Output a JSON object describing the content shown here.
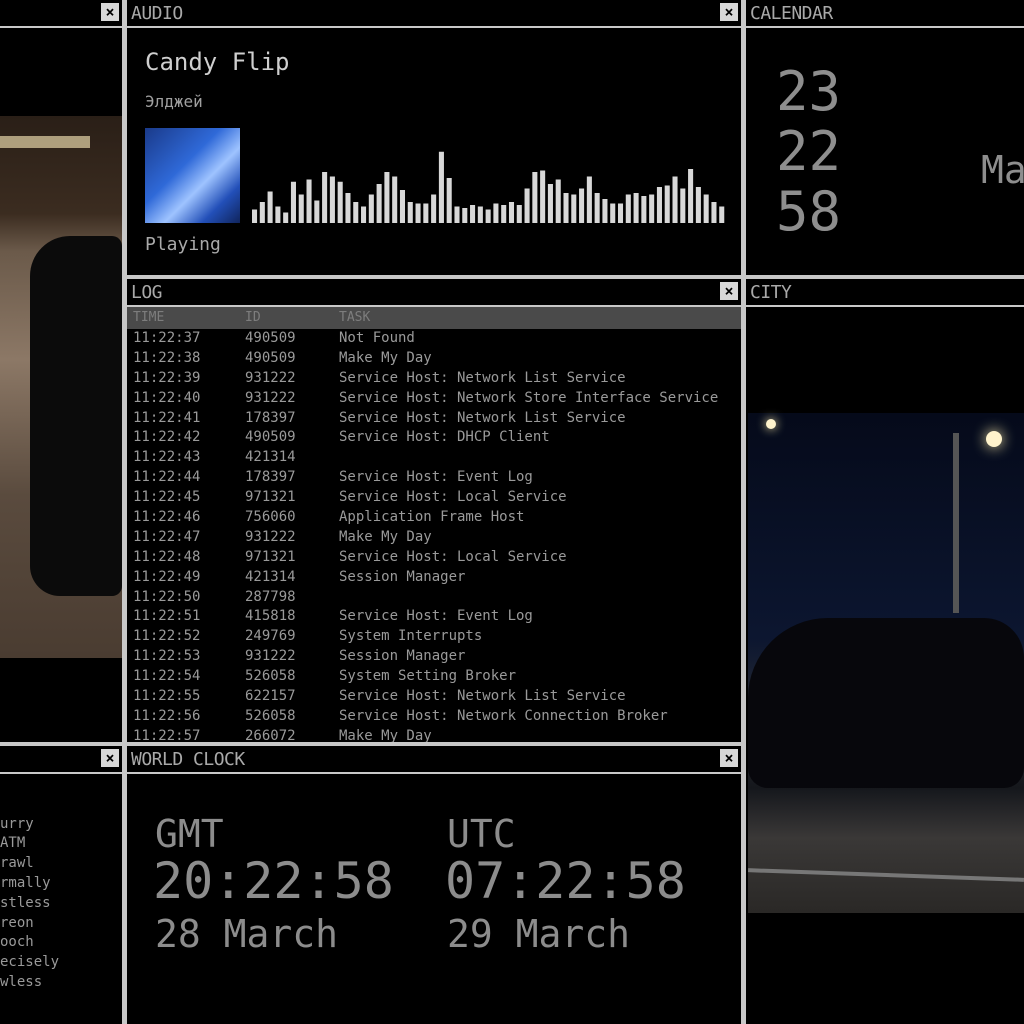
{
  "panels": {
    "audio": {
      "title": "AUDIO"
    },
    "calendar": {
      "title": "CALENDAR"
    },
    "log": {
      "title": "LOG"
    },
    "city": {
      "title": "CITY"
    },
    "world_clock": {
      "title": "WORLD CLOCK"
    },
    "close_glyph": "×"
  },
  "audio": {
    "track": "Candy Flip",
    "artist": "Элджей",
    "status": "Playing",
    "levels": [
      0.18,
      0.28,
      0.42,
      0.22,
      0.14,
      0.55,
      0.38,
      0.58,
      0.3,
      0.68,
      0.62,
      0.55,
      0.4,
      0.28,
      0.22,
      0.38,
      0.52,
      0.68,
      0.62,
      0.44,
      0.28,
      0.26,
      0.26,
      0.38,
      0.95,
      0.6,
      0.22,
      0.2,
      0.24,
      0.22,
      0.18,
      0.26,
      0.24,
      0.28,
      0.24,
      0.46,
      0.68,
      0.7,
      0.52,
      0.58,
      0.4,
      0.38,
      0.46,
      0.62,
      0.4,
      0.32,
      0.26,
      0.26,
      0.38,
      0.4,
      0.36,
      0.38,
      0.48,
      0.5,
      0.62,
      0.46,
      0.72,
      0.48,
      0.38,
      0.28,
      0.22
    ],
    "bar_color": "#d8d8d8"
  },
  "calendar": {
    "line1": "23",
    "line2": "22",
    "line3": "58",
    "month": "Ma"
  },
  "log": {
    "headers": {
      "time": "TIME",
      "id": "ID",
      "task": "TASK"
    },
    "rows": [
      {
        "time": "11:22:37",
        "id": "490509",
        "task": "Not Found"
      },
      {
        "time": "11:22:38",
        "id": "490509",
        "task": "Make My Day"
      },
      {
        "time": "11:22:39",
        "id": "931222",
        "task": "Service Host: Network List Service"
      },
      {
        "time": "11:22:40",
        "id": "931222",
        "task": "Service Host: Network Store Interface Service"
      },
      {
        "time": "11:22:41",
        "id": "178397",
        "task": "Service Host: Network List Service"
      },
      {
        "time": "11:22:42",
        "id": "490509",
        "task": "Service Host: DHCP Client"
      },
      {
        "time": "11:22:43",
        "id": "421314",
        "task": ""
      },
      {
        "time": "11:22:44",
        "id": "178397",
        "task": "Service Host: Event Log"
      },
      {
        "time": "11:22:45",
        "id": "971321",
        "task": "Service Host: Local Service"
      },
      {
        "time": "11:22:46",
        "id": "756060",
        "task": "Application Frame Host"
      },
      {
        "time": "11:22:47",
        "id": "931222",
        "task": "Make My Day"
      },
      {
        "time": "11:22:48",
        "id": "971321",
        "task": "Service Host: Local Service"
      },
      {
        "time": "11:22:49",
        "id": "421314",
        "task": "Session Manager"
      },
      {
        "time": "11:22:50",
        "id": "287798",
        "task": ""
      },
      {
        "time": "11:22:51",
        "id": "415818",
        "task": "Service Host: Event Log"
      },
      {
        "time": "11:22:52",
        "id": "249769",
        "task": "System Interrupts"
      },
      {
        "time": "11:22:53",
        "id": "931222",
        "task": "Session Manager"
      },
      {
        "time": "11:22:54",
        "id": "526058",
        "task": "System Setting Broker"
      },
      {
        "time": "11:22:55",
        "id": "622157",
        "task": "Service Host: Network List Service"
      },
      {
        "time": "11:22:56",
        "id": "526058",
        "task": "Service Host: Network Connection Broker"
      },
      {
        "time": "11:22:57",
        "id": "266072",
        "task": "Make My Day"
      }
    ]
  },
  "world_clock": {
    "left": {
      "zone": "GMT",
      "time": "20:22:58",
      "date": "28 March"
    },
    "right": {
      "zone": "UTC",
      "time": "07:22:58",
      "date": "29 March"
    }
  },
  "left_list": {
    "items": [
      "urry",
      "ATM",
      "rawl",
      "rmally",
      "stless",
      "reon",
      "ooch",
      "ecisely",
      "wless"
    ]
  }
}
